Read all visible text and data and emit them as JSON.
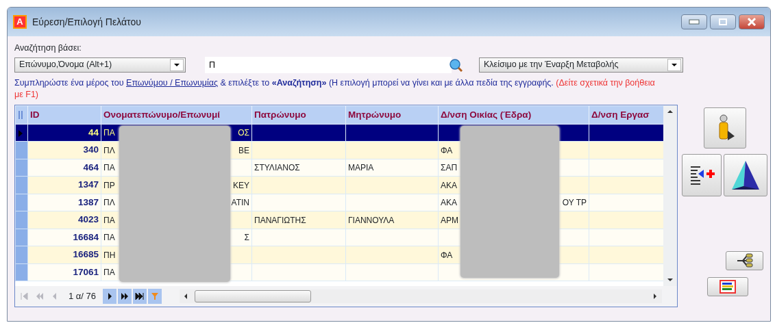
{
  "window": {
    "title": "Εύρεση/Επιλογή Πελάτου",
    "app_letter": "A"
  },
  "search_by": {
    "label": "Αναζήτηση βάσει:",
    "value": "Επώνυμο,Όνομα (Alt+1)"
  },
  "search_field": {
    "value": "Π"
  },
  "close_mode": {
    "value": "Κλείσιμο με την Έναρξη Μεταβολής"
  },
  "help": {
    "line1": "Συμπληρώστε ένα μέρος του",
    "link": "Επωνύμου / Επωνυμίας",
    "line2": "& επιλέξτε το **«Αναζήτηση»** (Η επιλογή μπορεί να γίνει και με άλλα πεδία της εγγραφής.",
    "note": "(Δείτε σχετικά την βοήθεια με F1)"
  },
  "table": {
    "columns": [
      "ID",
      "Ονοματεπώνυμο/Επωνυμί",
      "Πατρώνυμο",
      "Μητρώνυμο",
      "Δ/νση Οικίας (Έδρα)",
      "Δ/νση Εργασ"
    ],
    "rows": [
      {
        "id": "44",
        "name": {
          "start": "ΠΑ",
          "end": "ΟΣ"
        },
        "selected": true
      },
      {
        "id": "340",
        "name": {
          "start": "ΠΛ",
          "end": "ΒΕ"
        },
        "address": {
          "start": "ΦΑ"
        },
        "selected": false
      },
      {
        "id": "464",
        "name": {
          "start": "ΠΑ"
        },
        "father": "ΣΤΥΛΙΑΝΟΣ",
        "mother": "ΜΑΡΙΑ",
        "address": {
          "start": "ΣΑΠ"
        },
        "selected": false
      },
      {
        "id": "1347",
        "name": {
          "start": "ΠΡ",
          "end": "ΚΕΥ"
        },
        "address": {
          "start": "ΑΚΑ"
        },
        "selected": false
      },
      {
        "id": "1387",
        "name": {
          "start": "ΠΛ",
          "end": "ΑΤΙΝ"
        },
        "address": {
          "start": "ΑΚΑ",
          "end": "ΟΥ ΤΡ"
        },
        "selected": false
      },
      {
        "id": "4023",
        "name": {
          "start": "ΠΑ"
        },
        "father": "ΠΑΝΑΓΙΩΤΗΣ",
        "mother": "ΓΙΑΝΝΟΥΛΑ",
        "address": {
          "start": "ΑΡΜ"
        },
        "selected": false
      },
      {
        "id": "16684",
        "name": {
          "start": "ΠΑ",
          "end": "Σ"
        },
        "selected": false
      },
      {
        "id": "16685",
        "name": {
          "start": "ΠΗ"
        },
        "address": {
          "start": "ΦΑ"
        },
        "selected": false
      },
      {
        "id": "17061",
        "name": {
          "start": "ΠΑ"
        },
        "selected": false
      }
    ]
  },
  "navigator": {
    "position": "1 α/ 76",
    "buttons": [
      {
        "kind": "first",
        "disabled": true
      },
      {
        "kind": "prevpage",
        "disabled": true
      },
      {
        "kind": "prev",
        "disabled": true
      },
      {
        "kind": "next",
        "disabled": false
      },
      {
        "kind": "nextpage",
        "disabled": false
      },
      {
        "kind": "last",
        "disabled": false
      },
      {
        "kind": "filter",
        "disabled": false
      }
    ]
  }
}
